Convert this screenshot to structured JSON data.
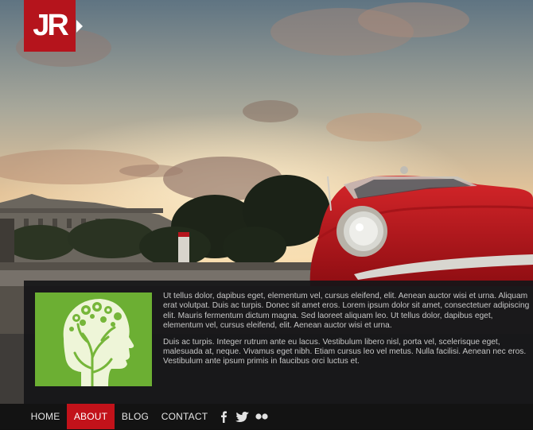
{
  "logo": {
    "text": "JR"
  },
  "content": {
    "paragraphs": [
      "Ut tellus dolor, dapibus eget, elementum vel, cursus eleifend, elit. Aenean auctor wisi et urna. Aliquam erat volutpat. Duis ac turpis. Donec sit amet eros. Lorem ipsum dolor sit amet, consectetuer adipiscing elit. Mauris fermentum dictum magna. Sed laoreet aliquam leo. Ut tellus dolor, dapibus eget, elementum vel, cursus eleifend, elit. Aenean auctor wisi et urna.",
      "Duis ac turpis. Integer rutrum ante eu lacus. Vestibulum libero nisl, porta vel, scelerisque eget, malesuada at, neque. Vivamus eget nibh. Etiam cursus leo vel metus. Nulla facilisi. Aenean nec eros. Vestibulum ante ipsum primis in faucibus orci luctus et."
    ]
  },
  "nav": {
    "items": [
      "HOME",
      "ABOUT",
      "BLOG",
      "CONTACT"
    ],
    "active": "ABOUT"
  },
  "social": [
    "facebook-icon",
    "twitter-icon",
    "flickr-icon"
  ],
  "colors": {
    "accent": "#c2121a",
    "thumb_green": "#76b63a",
    "panel": "#161618"
  }
}
